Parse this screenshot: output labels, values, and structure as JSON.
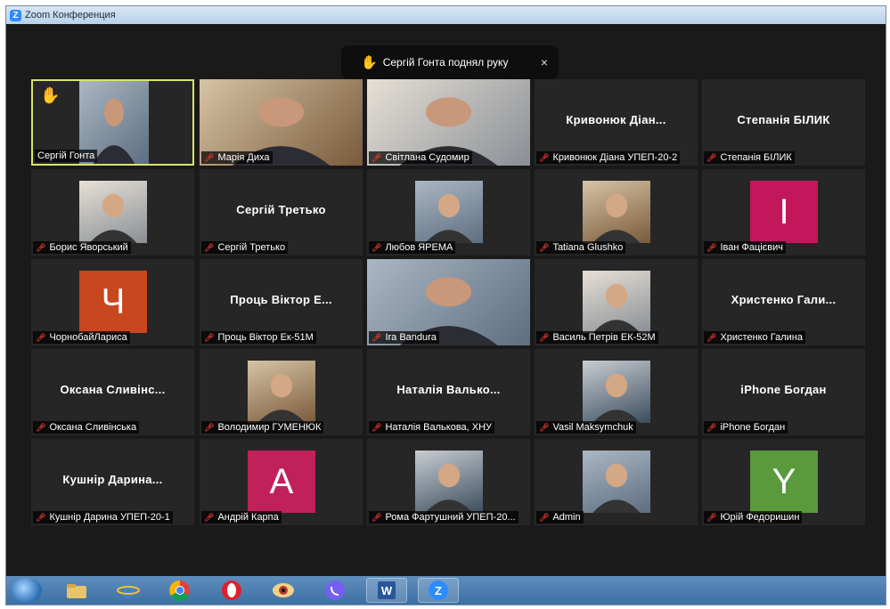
{
  "window": {
    "title": "Zoom Конференция"
  },
  "notification": {
    "text": "Сергій Гонта поднял руку",
    "close_glyph": "×"
  },
  "participants": [
    {
      "label": "Сергій Гонта",
      "type": "video",
      "active": true,
      "hand": true
    },
    {
      "label": "Марія Диха",
      "type": "video"
    },
    {
      "label": "Світлана Судомир",
      "type": "video"
    },
    {
      "label": "Кривонюк Діана УПЕП-20-2",
      "type": "name",
      "display": "Кривонюк Діан..."
    },
    {
      "label": "Степанія БІЛИК",
      "type": "name",
      "display": "Степанія БІЛИК"
    },
    {
      "label": "Борис Яворський",
      "type": "image"
    },
    {
      "label": "Сергій Третько",
      "type": "name",
      "display": "Сергій Третько"
    },
    {
      "label": "Любов ЯРЕМА",
      "type": "image"
    },
    {
      "label": "Tatiana Glushko",
      "type": "image"
    },
    {
      "label": "Іван Фацієвич",
      "type": "avatar",
      "letter": "І",
      "color": "#c2185b"
    },
    {
      "label": "ЧорнобайЛариса",
      "type": "avatar",
      "letter": "Ч",
      "color": "#c8471f"
    },
    {
      "label": "Проць Віктор Ек-51М",
      "type": "name",
      "display": "Проць Віктор Е..."
    },
    {
      "label": "Ira Bandura",
      "type": "video"
    },
    {
      "label": "Василь Петрів ЕК-52М",
      "type": "image"
    },
    {
      "label": "Христенко Галина",
      "type": "name",
      "display": "Христенко Гали..."
    },
    {
      "label": "Оксана Сливінська",
      "type": "name",
      "display": "Оксана Сливінс..."
    },
    {
      "label": "Володимир ГУМЕНЮК",
      "type": "image"
    },
    {
      "label": "Наталія Валькова, ХНУ",
      "type": "name",
      "display": "Наталія Валько..."
    },
    {
      "label": "Vasil Maksymchuk",
      "type": "image"
    },
    {
      "label": "iPhone Богдан",
      "type": "name",
      "display": "iPhone Богдан"
    },
    {
      "label": "Кушнір Дарина УПЕП-20-1",
      "type": "name",
      "display": "Кушнір Дарина..."
    },
    {
      "label": "Андрій Карпа",
      "type": "avatar",
      "letter": "А",
      "color": "#c0215a"
    },
    {
      "label": "Рома Фартушний УПЕП-20...",
      "type": "image"
    },
    {
      "label": "Admin",
      "type": "image"
    },
    {
      "label": "Юрій Федоришин",
      "type": "avatar",
      "letter": "Y",
      "color": "#5b9a3c"
    }
  ],
  "taskbar": {
    "items": [
      "explorer-icon",
      "ie-icon",
      "chrome-icon",
      "opera-icon",
      "eye-app-icon",
      "viber-icon",
      "word-icon",
      "zoom-icon"
    ],
    "word_glyph": "W",
    "zoom_glyph": "Z"
  }
}
